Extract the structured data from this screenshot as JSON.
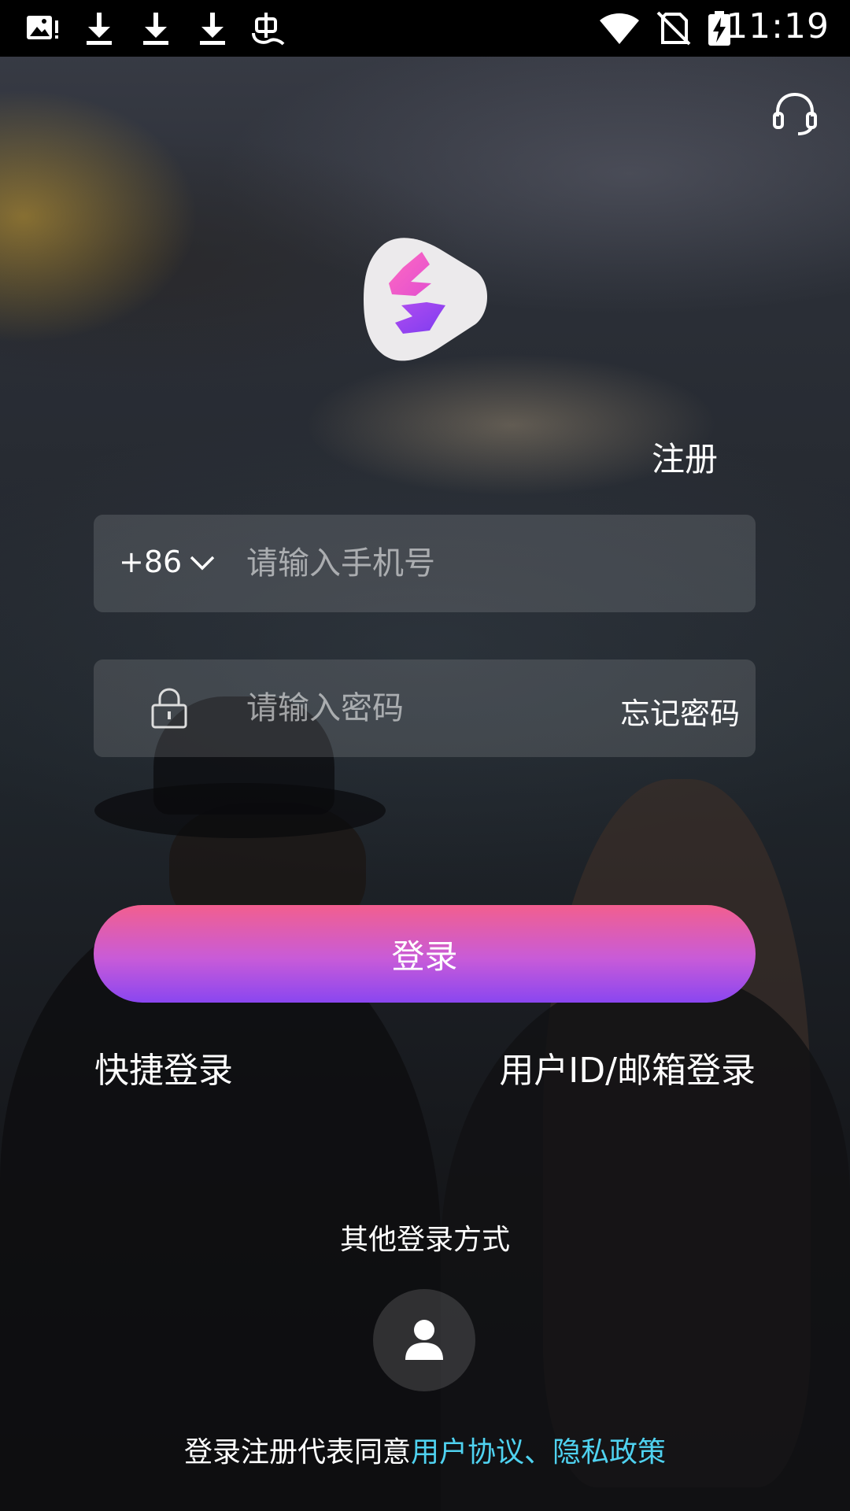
{
  "status_bar": {
    "icons": [
      "image-alert-icon",
      "download-icon",
      "download-icon",
      "download-icon",
      "bug-icon"
    ],
    "right_icons": [
      "wifi-icon",
      "no-sim-icon",
      "battery-charging-icon"
    ],
    "time": "11:19"
  },
  "header": {
    "support_icon": "headset-icon"
  },
  "logo": {
    "icon": "app-logo-icon",
    "colors": {
      "pink": "#f35ec0",
      "purple": "#9b4bf2",
      "badge": "#eeeeee"
    }
  },
  "register_label": "注册",
  "phone": {
    "country_code": "+86",
    "placeholder": "请输入手机号",
    "value": ""
  },
  "password": {
    "placeholder": "请输入密码",
    "value": "",
    "forgot_label": "忘记密码"
  },
  "login_button": {
    "label": "登录",
    "gradient": [
      "#f25f8f",
      "#8a46f0"
    ]
  },
  "alt_logins": {
    "quick": "快捷登录",
    "id_email": "用户ID/邮箱登录"
  },
  "other_methods": {
    "title": "其他登录方式",
    "guest_icon": "person-icon"
  },
  "agreement": {
    "prefix": "登录注册代表同意",
    "user_agreement": "用户协议",
    "separator": "、",
    "privacy_policy": "隐私政策",
    "link_color": "#4fd2f0"
  }
}
